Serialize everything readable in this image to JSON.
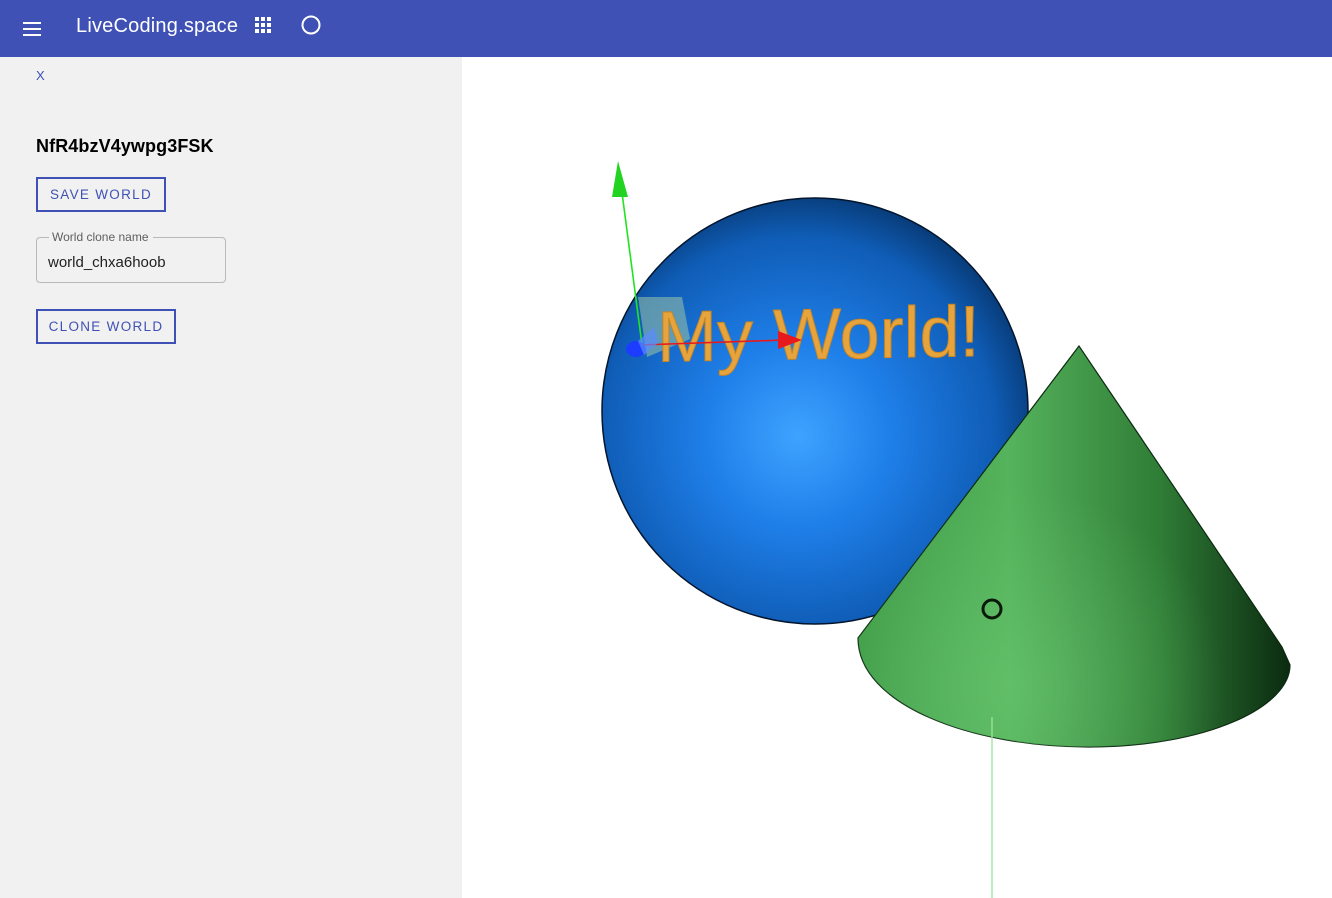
{
  "appbar": {
    "title": "LiveCoding.space",
    "menu_icon": "menu-icon",
    "apps_icon": "apps-grid-icon",
    "status_icon": "circle-outline-icon",
    "color": "#3f51b5"
  },
  "sidebar": {
    "close_label": "X",
    "world_id": "NfR4bzV4ywpg3FSK",
    "save_button_label": "SAVE WORLD",
    "clone_name_label": "World clone name",
    "clone_name_value": "world_chxa6hoob",
    "clone_button_label": "CLONE WORLD"
  },
  "scene": {
    "text_3d": "My World!",
    "sphere_color": "#1e7ee8",
    "cone_color": "#4caf50",
    "text_color": "#e8a43c"
  }
}
